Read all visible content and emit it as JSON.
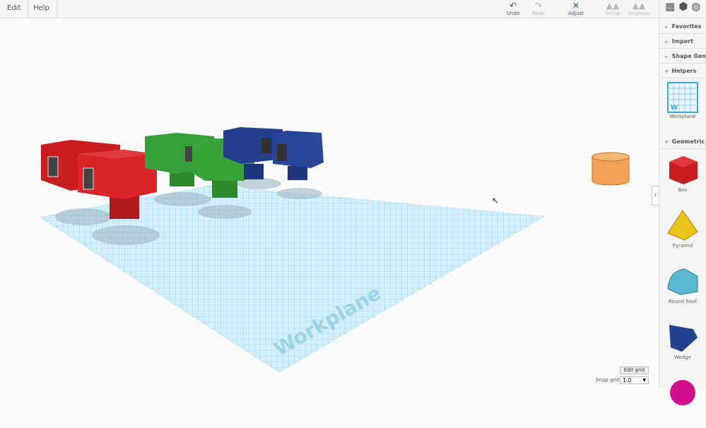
{
  "menu": {
    "edit": "Edit",
    "help": "Help"
  },
  "toolbar": {
    "undo": "Undo",
    "redo": "Redo",
    "adjust": "Adjust",
    "group": "Group",
    "ungroup": "Ungroup"
  },
  "workplane_label": "Workplane",
  "sidebar": {
    "sections": {
      "favorites": "Favorites",
      "import": "Import",
      "shape_gen": "Shape Generators",
      "helpers": "Helpers",
      "geometric": "Geometric"
    },
    "helpers": [
      {
        "label": "Workplane"
      }
    ],
    "shapes": [
      {
        "label": "Box",
        "color": "#c81e22"
      },
      {
        "label": "Pyramid",
        "color": "#e8c31a"
      },
      {
        "label": "Round Roof",
        "color": "#5bb8d0"
      },
      {
        "label": "Wedge",
        "color": "#25408f"
      }
    ]
  },
  "grid": {
    "edit_label": "Edit grid",
    "snap_label": "Snap grid",
    "snap_value": "1.0"
  }
}
